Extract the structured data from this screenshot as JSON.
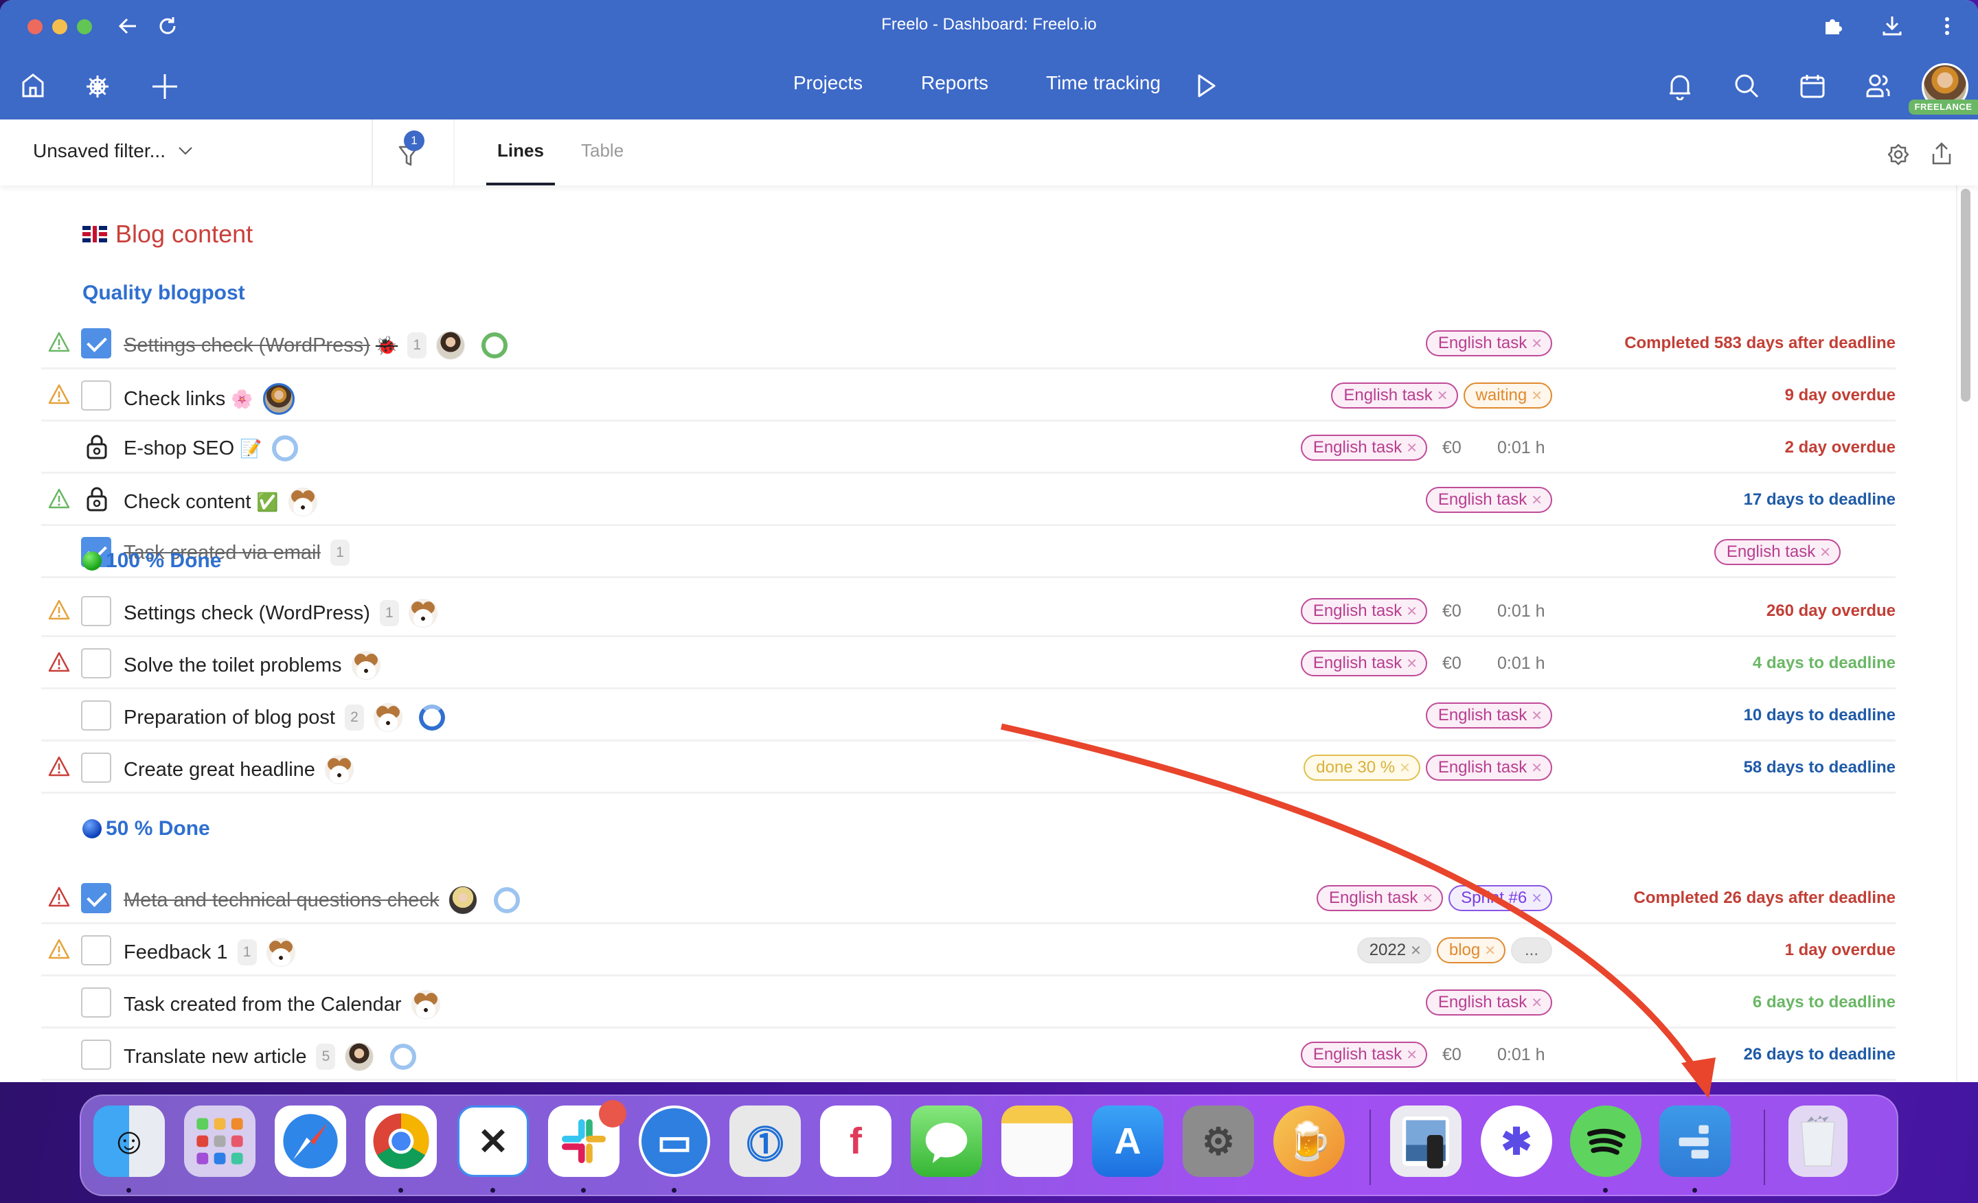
{
  "window": {
    "title": "Freelo - Dashboard: Freelo.io"
  },
  "header": {
    "nav": [
      "Projects",
      "Reports",
      "Time tracking"
    ],
    "user_badge": "FREELANCE",
    "icons": [
      "home-icon",
      "wheel-icon",
      "plus-icon",
      "play-icon",
      "bell-icon",
      "search-icon",
      "calendar-icon",
      "users-icon"
    ]
  },
  "filterbar": {
    "filter_label": "Unsaved filter...",
    "filter_count": "1",
    "tabs": [
      {
        "label": "Lines",
        "active": true
      },
      {
        "label": "Table",
        "active": false
      }
    ]
  },
  "project": {
    "title": "Blog content",
    "flag": "uk-flag",
    "sections": [
      {
        "title": "Quality blogpost",
        "icon": "",
        "tasks": [
          {
            "name": "Settings check (WordPress)",
            "emoji": "🐞",
            "done": true,
            "warning": "green",
            "locked": false,
            "count": "1",
            "assignee": "woman",
            "progress": "green-ring",
            "tags": [
              {
                "label": "English task",
                "type": "english"
              }
            ],
            "money": "",
            "hours": "",
            "deadline": "Completed 583 days after deadline",
            "deadline_color": "red"
          },
          {
            "name": "Check links",
            "emoji": "🌸",
            "done": false,
            "warning": "orange",
            "locked": false,
            "count": "",
            "assignee": "woman3",
            "progress": "",
            "tags": [
              {
                "label": "English task",
                "type": "english"
              },
              {
                "label": "waiting",
                "type": "waiting"
              }
            ],
            "money": "",
            "hours": "",
            "deadline": "9 day overdue",
            "deadline_color": "red"
          },
          {
            "name": "E-shop SEO",
            "emoji": "📝",
            "done": false,
            "warning": "",
            "locked": true,
            "count": "",
            "assignee": "",
            "progress": "ring",
            "tags": [
              {
                "label": "English task",
                "type": "english"
              }
            ],
            "money": "€0",
            "hours": "0:01 h",
            "deadline": "2 day overdue",
            "deadline_color": "red"
          },
          {
            "name": "Check content",
            "emoji": "✅",
            "done": false,
            "warning": "green",
            "locked": true,
            "count": "",
            "assignee": "dog",
            "progress": "",
            "tags": [
              {
                "label": "English task",
                "type": "english"
              }
            ],
            "money": "",
            "hours": "",
            "deadline": "17 days to deadline",
            "deadline_color": "blue"
          },
          {
            "name": "Task created via email",
            "emoji": "",
            "done": true,
            "warning": "",
            "locked": false,
            "count": "1",
            "assignee": "",
            "progress": "",
            "tags": [
              {
                "label": "English task",
                "type": "english"
              }
            ],
            "money": "",
            "hours": "",
            "deadline": "",
            "deadline_color": ""
          }
        ]
      },
      {
        "title": "100 % Done",
        "icon": "green-circle",
        "tasks": [
          {
            "name": "Settings check (WordPress)",
            "emoji": "",
            "done": false,
            "warning": "orange",
            "locked": false,
            "count": "1",
            "assignee": "dog",
            "progress": "",
            "tags": [
              {
                "label": "English task",
                "type": "english"
              }
            ],
            "money": "€0",
            "hours": "0:01 h",
            "deadline": "260 day overdue",
            "deadline_color": "red"
          },
          {
            "name": "Solve the toilet problems",
            "emoji": "",
            "done": false,
            "warning": "red",
            "locked": false,
            "count": "",
            "assignee": "dog",
            "progress": "",
            "tags": [
              {
                "label": "English task",
                "type": "english"
              }
            ],
            "money": "€0",
            "hours": "0:01 h",
            "deadline": "4 days to deadline",
            "deadline_color": "green"
          },
          {
            "name": "Preparation of blog post",
            "emoji": "",
            "done": false,
            "warning": "",
            "locked": false,
            "count": "2",
            "assignee": "dog",
            "progress": "half-ring",
            "tags": [
              {
                "label": "English task",
                "type": "english"
              }
            ],
            "money": "",
            "hours": "",
            "deadline": "10 days to deadline",
            "deadline_color": "blue"
          },
          {
            "name": "Create great headline",
            "emoji": "",
            "done": false,
            "warning": "red",
            "locked": false,
            "count": "",
            "assignee": "dog",
            "progress": "",
            "tags": [
              {
                "label": "done 30 %",
                "type": "done30"
              },
              {
                "label": "English task",
                "type": "english"
              }
            ],
            "money": "",
            "hours": "",
            "deadline": "58 days to deadline",
            "deadline_color": "blue"
          }
        ]
      },
      {
        "title": "50 % Done",
        "icon": "blue-circle",
        "tasks": [
          {
            "name": "Meta and technical questions check",
            "emoji": "",
            "done": true,
            "warning": "red",
            "locked": false,
            "count": "",
            "assignee": "woman2",
            "progress": "ring",
            "tags": [
              {
                "label": "English task",
                "type": "english"
              },
              {
                "label": "Sprint #6",
                "type": "sprint"
              }
            ],
            "money": "",
            "hours": "",
            "deadline": "Completed 26 days after deadline",
            "deadline_color": "red"
          },
          {
            "name": "Feedback 1",
            "emoji": "",
            "done": false,
            "warning": "orange",
            "locked": false,
            "count": "1",
            "assignee": "dog",
            "progress": "",
            "tags": [
              {
                "label": "2022",
                "type": "year"
              },
              {
                "label": "blog",
                "type": "blog"
              },
              {
                "label": "...",
                "type": "more"
              }
            ],
            "money": "",
            "hours": "",
            "deadline": "1 day overdue",
            "deadline_color": "red"
          },
          {
            "name": "Task created from the Calendar",
            "emoji": "",
            "done": false,
            "warning": "",
            "locked": false,
            "count": "",
            "assignee": "dog",
            "progress": "",
            "tags": [
              {
                "label": "English task",
                "type": "english"
              }
            ],
            "money": "",
            "hours": "",
            "deadline": "6 days to deadline",
            "deadline_color": "green"
          },
          {
            "name": "Translate new article",
            "emoji": "",
            "done": false,
            "warning": "",
            "locked": false,
            "count": "5",
            "assignee": "woman",
            "progress": "ring",
            "tags": [
              {
                "label": "English task",
                "type": "english"
              }
            ],
            "money": "€0",
            "hours": "0:01 h",
            "deadline": "26 days to deadline",
            "deadline_color": "blue"
          }
        ]
      }
    ]
  },
  "colors": {
    "header_blue": "#3d69c7",
    "project_red": "#c9403a",
    "section_blue": "#2f6fcf",
    "deadline_red": "#c23e35",
    "deadline_blue": "#1f5aa6",
    "deadline_green": "#6ab765",
    "annotation_arrow": "#e8452c"
  },
  "dock": {
    "apps": [
      {
        "name": "Finder",
        "running": true
      },
      {
        "name": "Launchpad",
        "running": false
      },
      {
        "name": "Safari",
        "running": false
      },
      {
        "name": "Chrome",
        "running": true
      },
      {
        "name": "Missive",
        "running": true
      },
      {
        "name": "Slack",
        "running": true,
        "badge": true
      },
      {
        "name": "Messenger",
        "running": true
      },
      {
        "name": "1Password",
        "running": false
      },
      {
        "name": "Freelo",
        "running": false
      },
      {
        "name": "Messages",
        "running": false
      },
      {
        "name": "Notes",
        "running": false
      },
      {
        "name": "App Store",
        "running": false
      },
      {
        "name": "System Preferences",
        "running": false
      },
      {
        "name": "Beer app",
        "running": false
      },
      {
        "name": "Preview",
        "running": false
      },
      {
        "name": "Zapier",
        "running": false
      },
      {
        "name": "Spotify",
        "running": true
      },
      {
        "name": "Freelo desktop",
        "running": true
      },
      {
        "name": "Trash",
        "running": false
      }
    ]
  }
}
